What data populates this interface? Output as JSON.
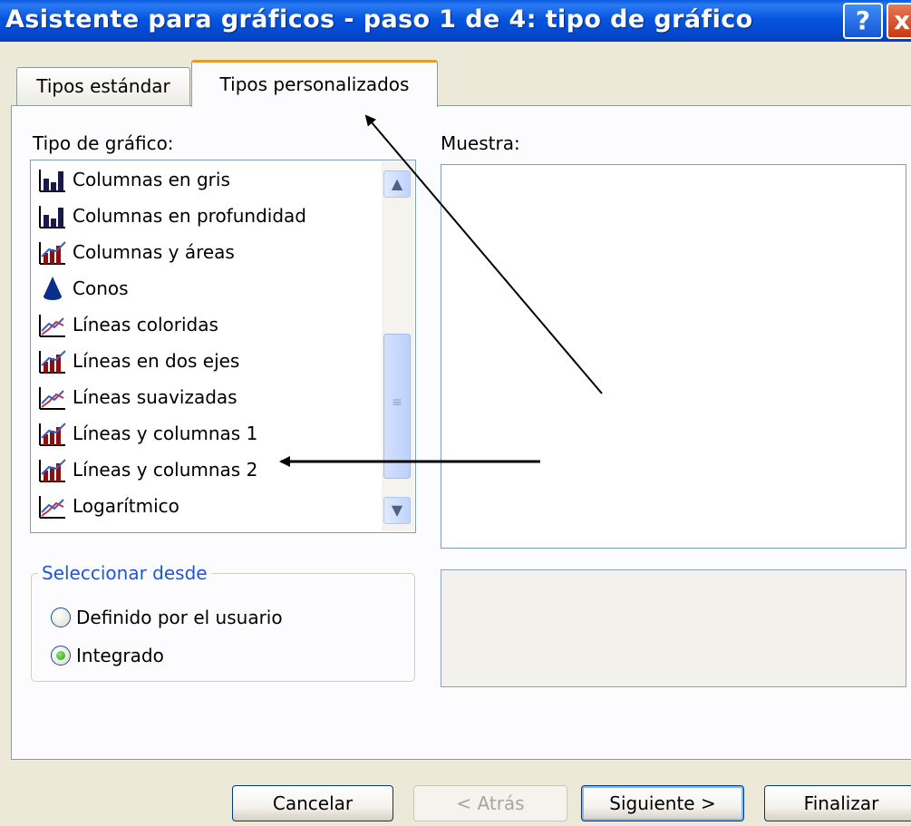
{
  "window": {
    "title": "Asistente para gráficos - paso 1 de 4: tipo de gráfico",
    "help_label": "?",
    "close_label": "x"
  },
  "tabs": [
    {
      "label": "Tipos estándar",
      "selected": false
    },
    {
      "label": "Tipos personalizados",
      "selected": true
    }
  ],
  "chart_types": {
    "label": "Tipo de gráfico:",
    "items": [
      {
        "label": "Columnas en gris",
        "icon": "column-chart-icon"
      },
      {
        "label": "Columnas en profundidad",
        "icon": "column-chart-icon"
      },
      {
        "label": "Columnas y áreas",
        "icon": "column-line-chart-icon"
      },
      {
        "label": "Conos",
        "icon": "cone-icon"
      },
      {
        "label": "Líneas coloridas",
        "icon": "line-chart-icon"
      },
      {
        "label": "Líneas en dos ejes",
        "icon": "column-line-chart-icon"
      },
      {
        "label": "Líneas suavizadas",
        "icon": "line-chart-icon"
      },
      {
        "label": "Líneas y columnas 1",
        "icon": "column-line-chart-icon"
      },
      {
        "label": "Líneas y columnas 2",
        "icon": "column-line-chart-icon"
      },
      {
        "label": "Logarítmico",
        "icon": "line-chart-icon"
      }
    ]
  },
  "sample": {
    "label": "Muestra:"
  },
  "select_from": {
    "legend": "Seleccionar desde",
    "options": [
      {
        "label": "Definido por el usuario",
        "checked": false
      },
      {
        "label": "Integrado",
        "checked": true
      }
    ]
  },
  "buttons": {
    "cancel": "Cancelar",
    "back": "< Atrás",
    "next": "Siguiente >",
    "finish": "Finalizar"
  },
  "colors": {
    "titlebar": "#0A5BE0",
    "tab_accent": "#E69A28",
    "group_legend": "#1E56D6",
    "radio_checked": "#21A121"
  }
}
